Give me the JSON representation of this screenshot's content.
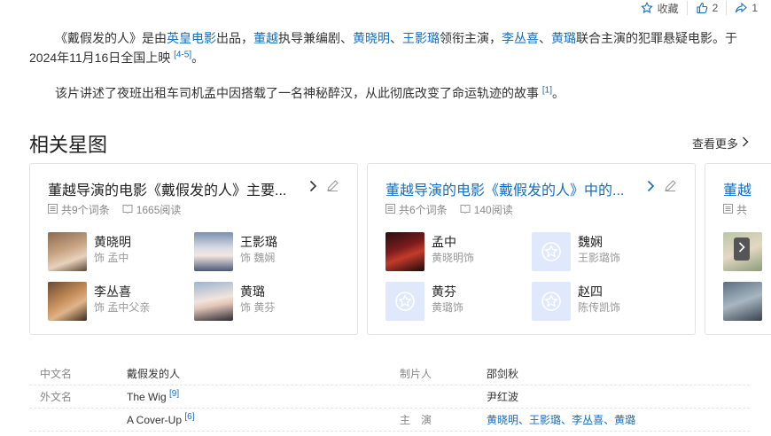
{
  "actions": {
    "favorite": "收藏",
    "likes": "2",
    "shares": "1"
  },
  "para1": {
    "t1": "《戴假发的人》是由",
    "l1": "英皇电影",
    "t2": "出品，",
    "l2": "董越",
    "t3": "执导兼编剧、",
    "l3": "黄晓明",
    "t4": "、",
    "l4": "王影璐",
    "t5": "领衔主演，",
    "l5": "李丛喜",
    "t6": "、",
    "l6": "黄璐",
    "t7": "联合主演的犯罪悬疑电影。于2024年11月16日全国上映",
    "ref": "[4-5]",
    "t8": "。"
  },
  "para2": {
    "text": "该片讲述了夜班出租车司机孟中因搭载了一名神秘醉汉，从此彻底改变了命运轨迹的故事",
    "ref": "[1]",
    "end": "。"
  },
  "section": {
    "title": "相关星图",
    "more": "查看更多"
  },
  "cards": [
    {
      "title": "董越导演的电影《戴假发的人》主要...",
      "entries": "共9个词条",
      "reads": "1665阅读",
      "people": [
        {
          "name": "黄晓明",
          "role": "饰 孟中"
        },
        {
          "name": "王影璐",
          "role": "饰 魏娴"
        },
        {
          "name": "李丛喜",
          "role": "饰 孟中父亲"
        },
        {
          "name": "黄璐",
          "role": "饰 黄芬"
        }
      ]
    },
    {
      "title": "董越导演的电影《戴假发的人》中的...",
      "entries": "共6个词条",
      "reads": "140阅读",
      "people": [
        {
          "name": "孟中",
          "role": "黄晓明饰"
        },
        {
          "name": "魏娴",
          "role": "王影璐饰"
        },
        {
          "name": "黄芬",
          "role": "黄璐饰"
        },
        {
          "name": "赵四",
          "role": "陈传凯饰"
        }
      ]
    },
    {
      "title": "董越",
      "entries": "共"
    }
  ],
  "info": {
    "rows": [
      {
        "label": "中文名",
        "value": "戴假发的人",
        "label2": "制片人",
        "value2": "邵剑秋"
      },
      {
        "label": "外文名",
        "value": "The Wig",
        "ref": "[9]",
        "label2": "",
        "value2": "尹红波"
      },
      {
        "label": "",
        "value": "A Cover-Up",
        "ref": "[6]",
        "label2": "主　演"
      }
    ],
    "cast_links": [
      "黄晓明",
      "王影璐",
      "李丛喜",
      "黄璐"
    ],
    "cast_sep": "、"
  }
}
